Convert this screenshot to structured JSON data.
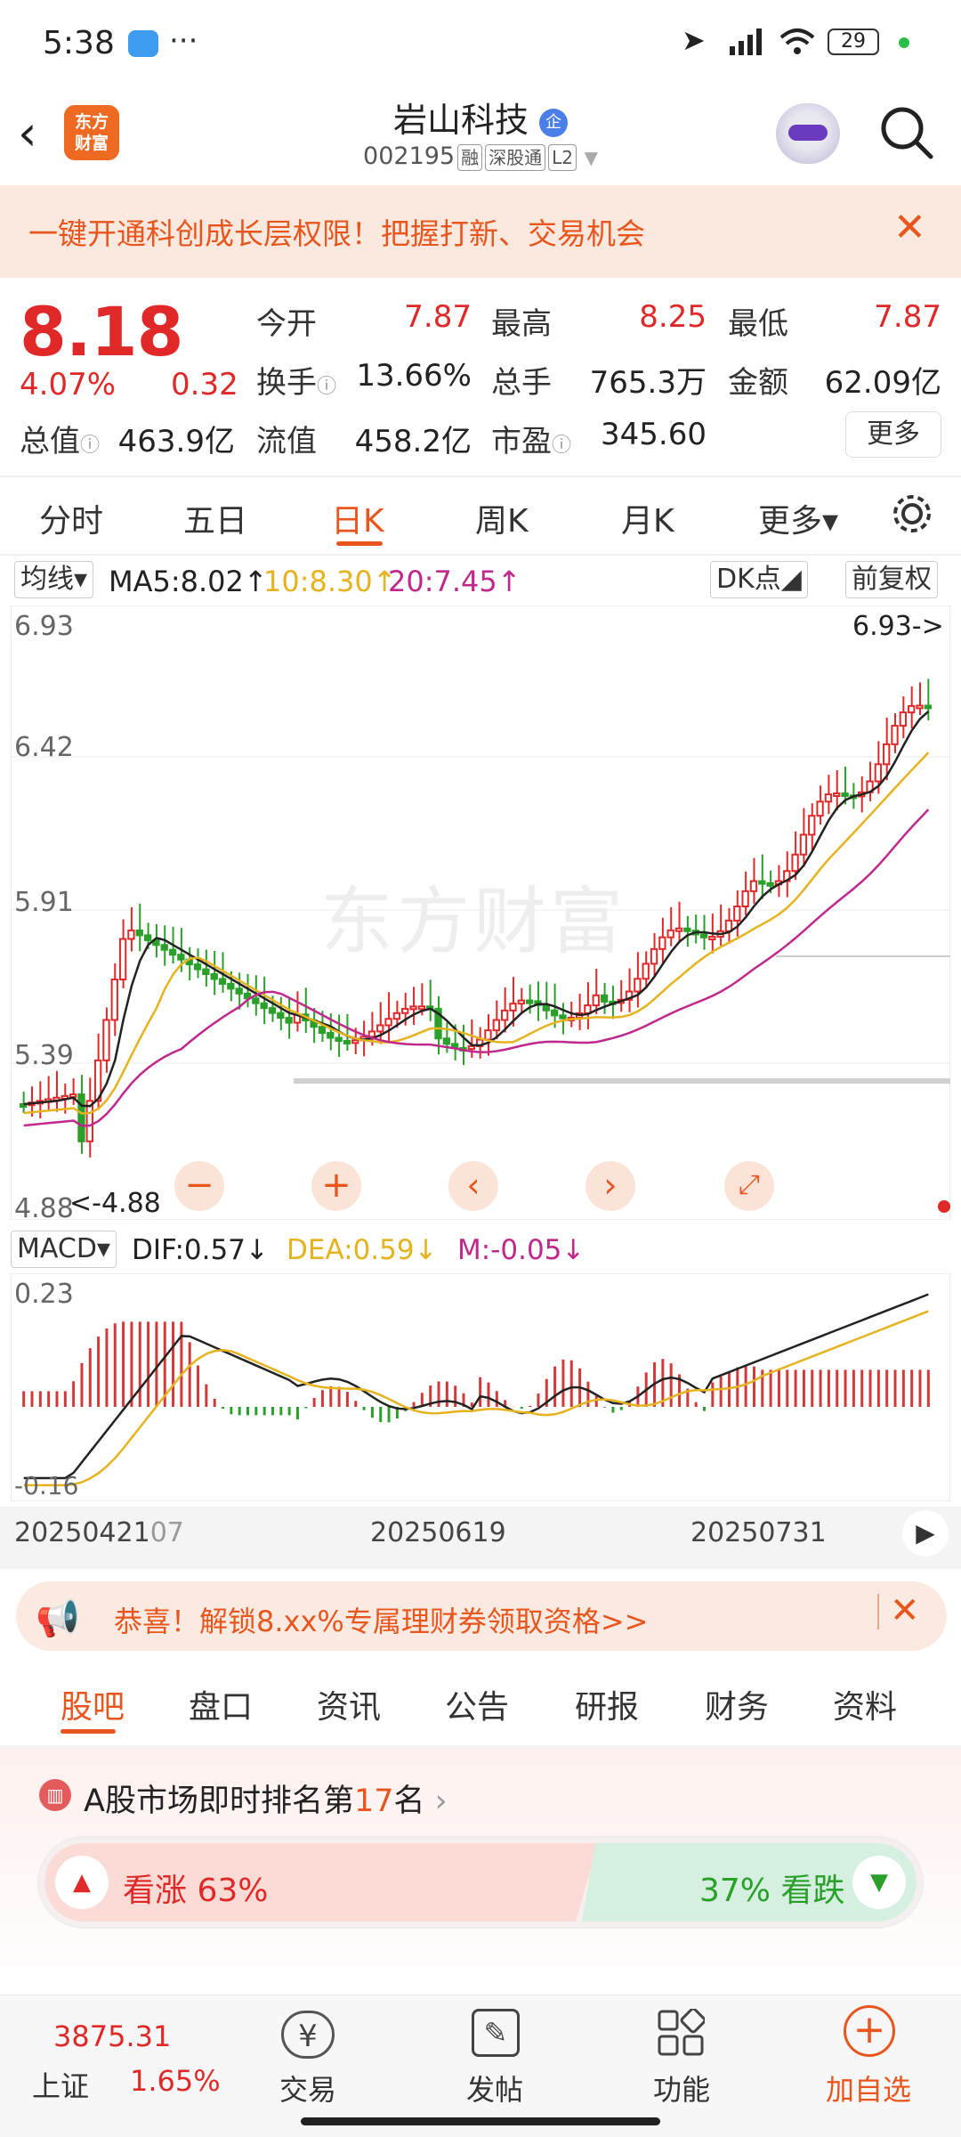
{
  "status": {
    "time": "5:38",
    "battery": "29"
  },
  "header": {
    "title": "岩山科技",
    "code": "002195",
    "tags": [
      "融",
      "深股通",
      "L2"
    ],
    "logo_line1": "东方",
    "logo_line2": "财富"
  },
  "banner": {
    "text": "一键开通科创成长层权限！把握打新、交易机会"
  },
  "quote": {
    "price": "8.18",
    "change_pct": "4.07%",
    "change": "0.32",
    "open_label": "今开",
    "open": "7.87",
    "high_label": "最高",
    "high": "8.25",
    "low_label": "最低",
    "low": "7.87",
    "turnover_label": "换手",
    "turnover": "13.66%",
    "volume_label": "总手",
    "volume": "765.3万",
    "amount_label": "金额",
    "amount": "62.09亿",
    "mktcap_label": "总值",
    "mktcap": "463.9亿",
    "float_label": "流值",
    "float": "458.2亿",
    "pe_label": "市盈",
    "pe": "345.60",
    "more": "更多"
  },
  "kline_tabs": [
    "分时",
    "五日",
    "日K",
    "周K",
    "月K",
    "更多▾"
  ],
  "ma_bar": {
    "selector": "均线▾",
    "ma5": "MA5:8.02↑",
    "ma10": "10:8.30↑",
    "ma20": "20:7.45↑",
    "dk": "DK点◢",
    "adjust": "前复权"
  },
  "price_axis": {
    "top": "6.93",
    "mid1": "6.42",
    "mid2": "5.91",
    "mid3": "5.39",
    "bottom": "4.88",
    "high_marker": "6.93->",
    "low_marker": "<-4.88",
    "watermark": "东方财富"
  },
  "macd": {
    "selector": "MACD▾",
    "dif": "DIF:0.57↓",
    "dea": "DEA:0.59↓",
    "m": "M:-0.05↓",
    "top": "0.23",
    "bottom": "-0.16"
  },
  "dates": {
    "d1": "20250421",
    "d1b": "07",
    "d2": "20250619",
    "d3": "20250731"
  },
  "notice": {
    "text": "恭喜！解锁8.xx%专属理财券领取资格>>"
  },
  "info_tabs": [
    "股吧",
    "盘口",
    "资讯",
    "公告",
    "研报",
    "财务",
    "资料"
  ],
  "ranking": {
    "prefix": "A股市场即时排名第",
    "rank": "17",
    "suffix": "名"
  },
  "sentiment": {
    "up_label": "看涨 63%",
    "down_label": "37% 看跌",
    "up_pct": 63
  },
  "bottom_nav": {
    "index_value": "3875.31",
    "index_name": "上证",
    "index_change": "1.65%",
    "trade": "交易",
    "post": "发帖",
    "function": "功能",
    "add_watch": "加自选"
  },
  "colors": {
    "up": "#e02828",
    "down": "#2aa02a",
    "accent": "#e8561e",
    "ma5": "#222222",
    "ma10": "#e6b21e",
    "ma20": "#c0288c"
  }
}
